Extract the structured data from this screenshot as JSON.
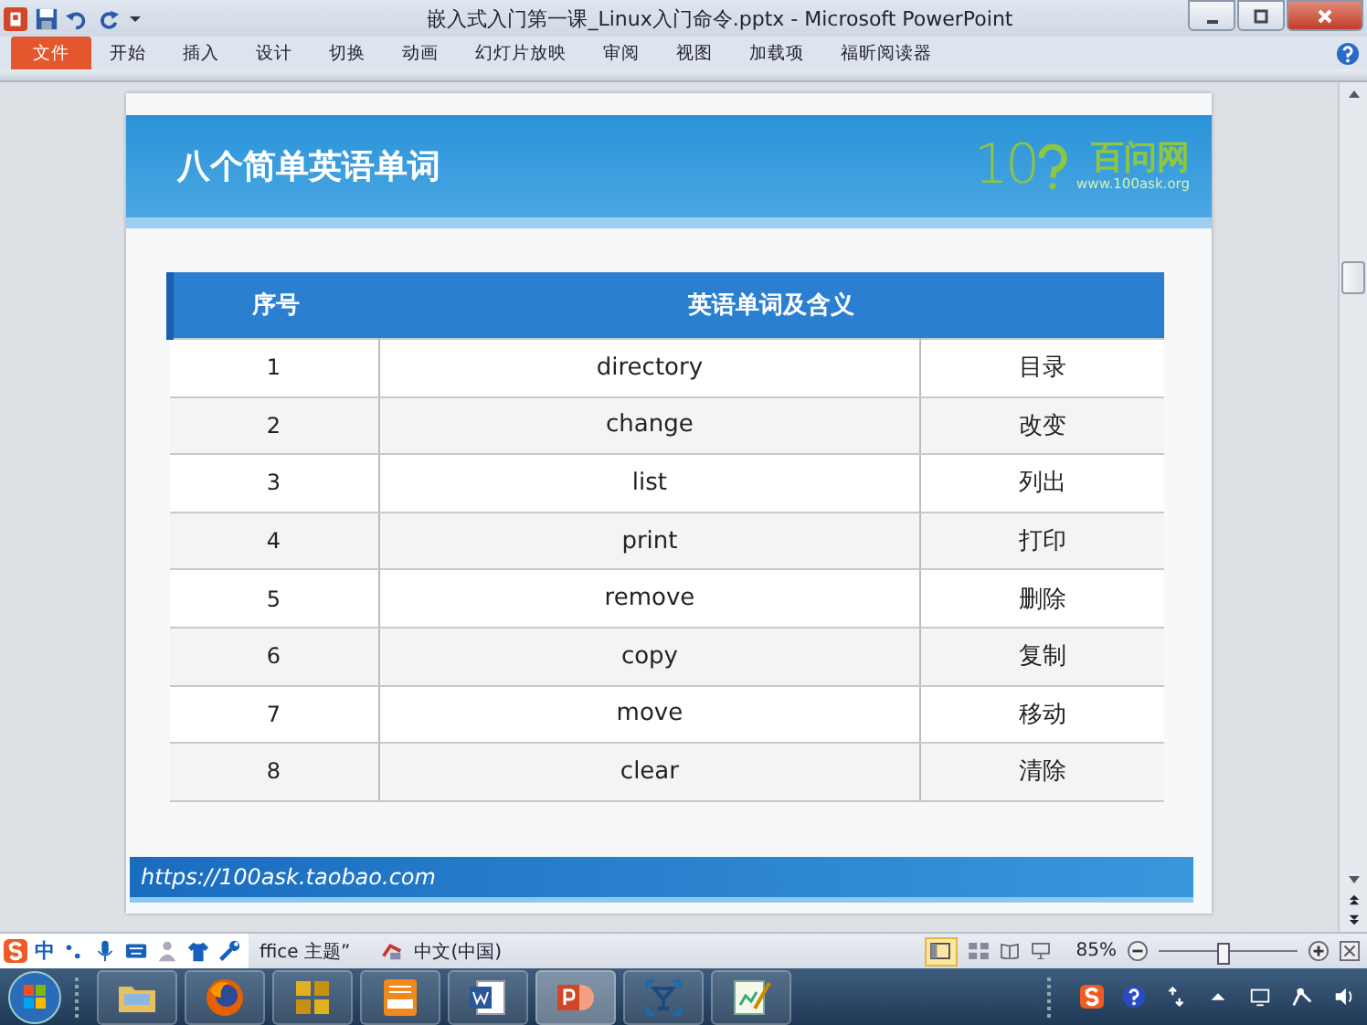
{
  "window": {
    "title": "嵌入式入门第一课_Linux入门命令.pptx - Microsoft PowerPoint"
  },
  "ribbon_tabs": [
    {
      "label": "文件",
      "kind": "file"
    },
    {
      "label": "开始",
      "kind": "tab"
    },
    {
      "label": "插入",
      "kind": "tab"
    },
    {
      "label": "设计",
      "kind": "tab"
    },
    {
      "label": "切换",
      "kind": "tab"
    },
    {
      "label": "动画",
      "kind": "tab"
    },
    {
      "label": "幻灯片放映",
      "kind": "tab"
    },
    {
      "label": "审阅",
      "kind": "tab"
    },
    {
      "label": "视图",
      "kind": "tab"
    },
    {
      "label": "加载项",
      "kind": "tab"
    },
    {
      "label": "福昕阅读器",
      "kind": "tab"
    }
  ],
  "slide": {
    "title": "八个简单英语单词",
    "logo": {
      "mark": "10",
      "name": "百问网",
      "url": "www.100ask.org"
    },
    "table": {
      "header": {
        "number": "序号",
        "word_and_meaning": "英语单词及含义"
      },
      "rows": [
        {
          "number": "1",
          "word": "directory",
          "meaning": "目录"
        },
        {
          "number": "2",
          "word": "change",
          "meaning": "改变"
        },
        {
          "number": "3",
          "word": "list",
          "meaning": "列出"
        },
        {
          "number": "4",
          "word": "print",
          "meaning": "打印"
        },
        {
          "number": "5",
          "word": "remove",
          "meaning": "删除"
        },
        {
          "number": "6",
          "word": "copy",
          "meaning": "复制"
        },
        {
          "number": "7",
          "word": "move",
          "meaning": "移动"
        },
        {
          "number": "8",
          "word": "clear",
          "meaning": "清除"
        }
      ]
    },
    "footer": "https://100ask.taobao.com"
  },
  "status_bar": {
    "ime": "中",
    "theme": "ffice 主题”",
    "language": "中文(中国)",
    "zoom": "85%",
    "zoom_slider": {
      "level": 0.45
    }
  }
}
